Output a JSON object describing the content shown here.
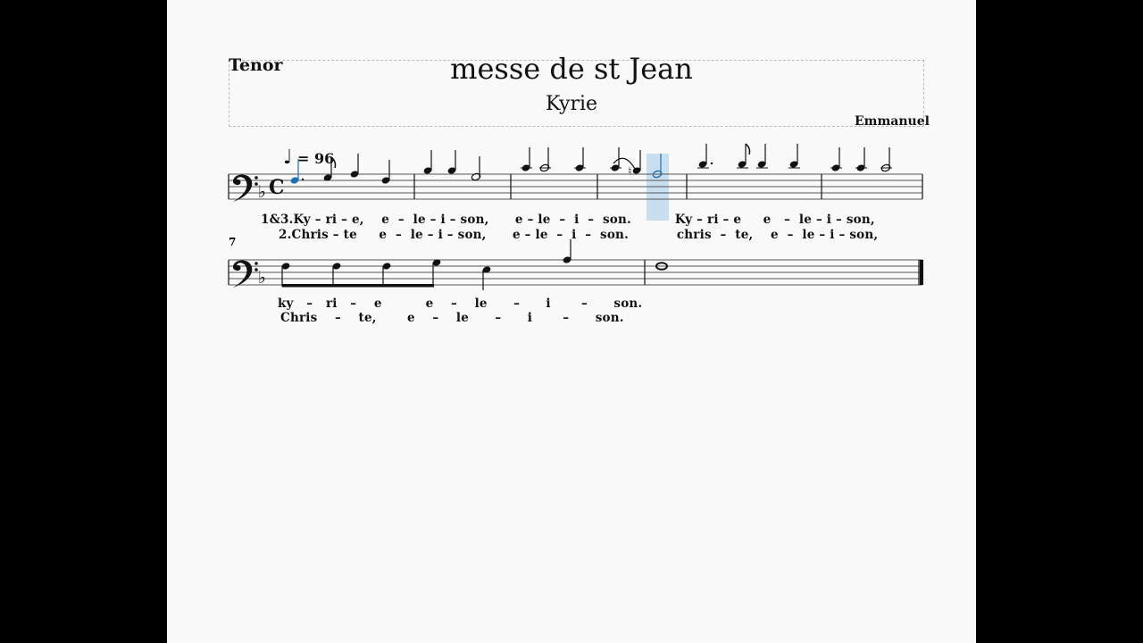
{
  "header": {
    "part": "Tenor",
    "title": "messe de st Jean",
    "subtitle": "Kyrie",
    "composer": "Emmanuel"
  },
  "tempo": {
    "note_glyph": "♩",
    "text": "= 96"
  },
  "system2": {
    "measure_number": "7"
  },
  "lyrics": {
    "s1_v1": "1&3.Ky – ri – e,    e  –  le – i – son,      e – le  –  i  –  son.          Ky – ri – e     e   –  le – i – son,",
    "s1_v2": "2.Chris – te     e  –  le – i – son,      e – le  –  i  –  son.           chris  –  te,    e  –  le – i – son,",
    "s2_v1": "ky   –   ri   –    e          e    –    le      –      i       –      son.",
    "s2_v2": "Chris    –    te,       e    –    le      –      i       –      son."
  },
  "colors": {
    "playhead": "#c9dff0",
    "current_note": "#1e6fb0"
  },
  "notes": {
    "playing_index": 11,
    "system1_pitches": [
      "A3",
      "G3",
      "A3",
      "F3",
      "B♭3",
      "B♭3",
      "G3",
      "C4",
      "C4",
      "C4",
      "C4",
      "B♮3",
      "A3",
      "D4",
      "D4",
      "D4",
      "D4",
      "C4",
      "C4",
      "C4"
    ],
    "system2_pitches": [
      "F3",
      "F3",
      "F3",
      "G3",
      "E3",
      "A3",
      "F3"
    ]
  }
}
